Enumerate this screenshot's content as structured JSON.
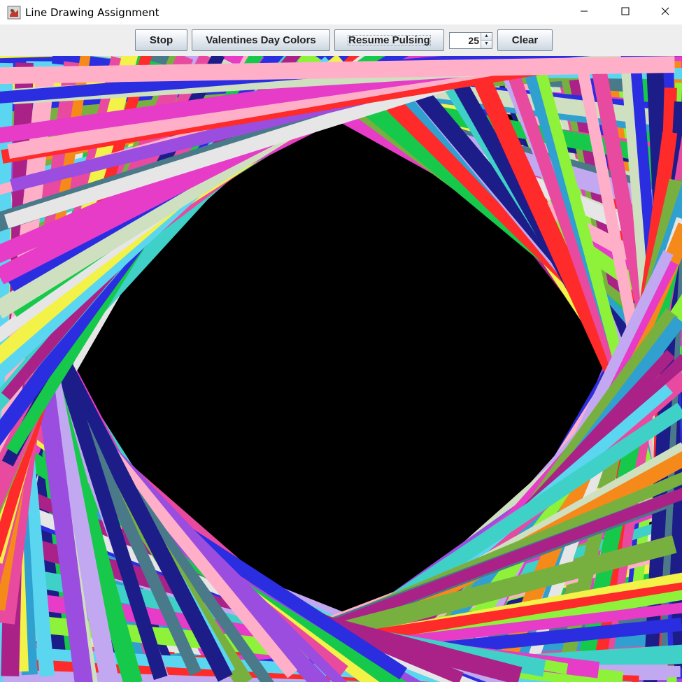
{
  "window": {
    "title": "Line Drawing Assignment",
    "app_icon": "java-coffee-icon",
    "controls": {
      "minimize_icon": "minimize-icon",
      "maximize_icon": "maximize-icon",
      "close_icon": "close-icon"
    }
  },
  "toolbar": {
    "stop_label": "Stop",
    "valentines_label": "Valentines Day Colors",
    "resume_label": "Resume Pulsing",
    "spinner_value": "25",
    "clear_label": "Clear"
  },
  "canvas": {
    "background": "#000000",
    "palette": [
      "#2b2ee0",
      "#8ef23a",
      "#e63cc8",
      "#f2f248",
      "#3fd0c8",
      "#ff2a2a",
      "#9b4de0",
      "#f58a1a",
      "#17c94a",
      "#cfe0c0",
      "#e84aa0",
      "#4a7a8a",
      "#c2a8f0",
      "#5bd6f0",
      "#1d1d8a",
      "#e6e6e6",
      "#78b040",
      "#aa2288",
      "#30a0d0",
      "#ffb0c8"
    ]
  }
}
